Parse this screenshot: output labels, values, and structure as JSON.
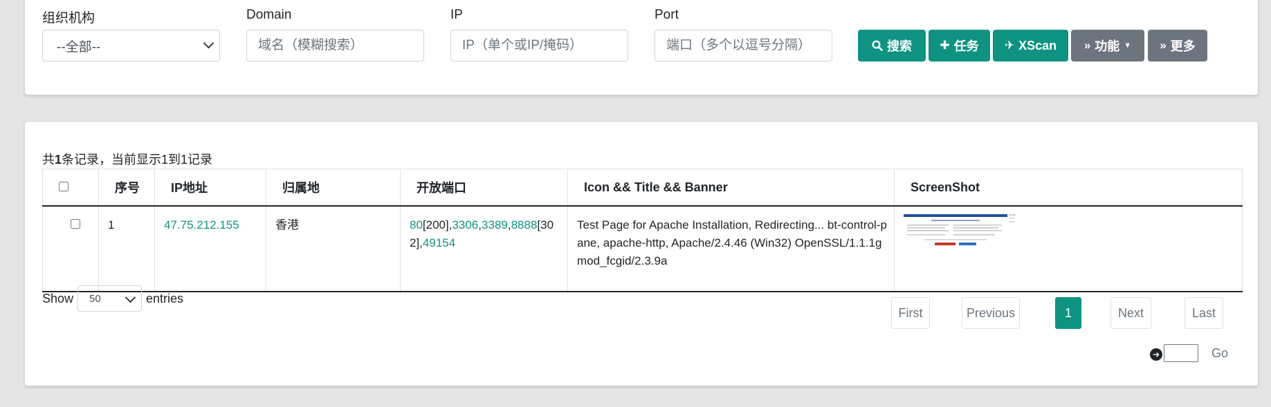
{
  "filters": {
    "org": {
      "label": "组织机构",
      "value": "--全部--"
    },
    "domain": {
      "label": "Domain",
      "placeholder": "域名（模糊搜索）"
    },
    "ip": {
      "label": "IP",
      "placeholder": "IP（单个或IP/掩码）"
    },
    "port": {
      "label": "Port",
      "placeholder": "端口（多个以逗号分隔）"
    }
  },
  "buttons": {
    "search": "搜索",
    "task": "任务",
    "xscan": "XScan",
    "function": "功能",
    "more": "更多"
  },
  "summary": {
    "prefix": "共",
    "total": "1",
    "middle": "条记录，当前显示1到1记录"
  },
  "table": {
    "headers": [
      "序号",
      "IP地址",
      "归属地",
      "开放端口",
      "Icon && Title && Banner",
      "ScreenShot"
    ],
    "rows": [
      {
        "index": "1",
        "ip": "47.75.212.155",
        "location": "香港",
        "ports": {
          "p80": "80",
          "s200": "[200],",
          "p3306": "3306",
          "c1": ",",
          "p3389": "3389",
          "c2": ",",
          "p8888": "8888",
          "s302": "[302],",
          "p49154": "49154"
        },
        "banner": "Test Page for Apache Installation, Redirecting... bt-control-pane, apache-http, Apache/2.4.46 (Win32) OpenSSL/1.1.1g mod_fcgid/2.3.9a"
      }
    ]
  },
  "length": {
    "show": "Show",
    "value": "50",
    "entries": "entries"
  },
  "pagination": {
    "first": "First",
    "previous": "Previous",
    "current": "1",
    "next": "Next",
    "last": "Last"
  },
  "goto": {
    "label": "Go"
  },
  "colors": {
    "accent": "#0e9382",
    "secondary": "#6c757d"
  }
}
